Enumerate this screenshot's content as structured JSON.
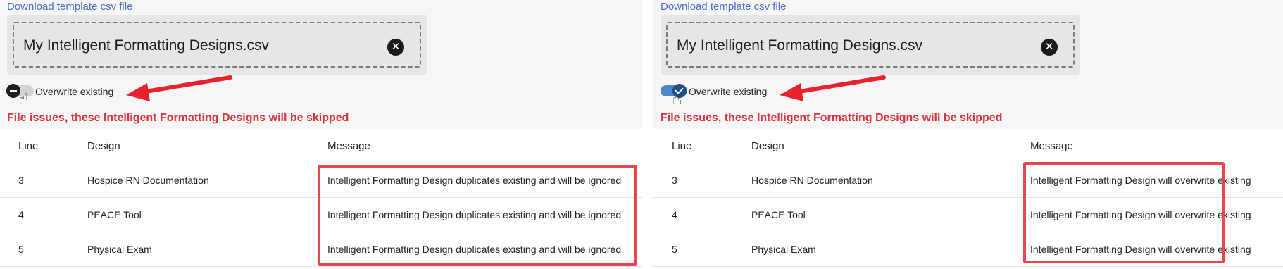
{
  "panels": [
    {
      "download_link": "Download template csv file",
      "file_name": "My Intelligent Formatting Designs.csv",
      "clear_icon": "close-circle-icon",
      "toggle_label": "Overwrite existing",
      "toggle_state": "off",
      "issues_heading": "File issues, these Intelligent Formatting Designs will be skipped",
      "table": {
        "headers": [
          "Line",
          "Design",
          "Message"
        ],
        "rows": [
          {
            "line": "3",
            "design": "Hospice RN Documentation",
            "message": "Intelligent Formatting Design duplicates existing and will be ignored"
          },
          {
            "line": "4",
            "design": "PEACE Tool",
            "message": "Intelligent Formatting Design duplicates existing and will be ignored"
          },
          {
            "line": "5",
            "design": "Physical Exam",
            "message": "Intelligent Formatting Design duplicates existing and will be ignored"
          }
        ]
      }
    },
    {
      "download_link": "Download template csv file",
      "file_name": "My Intelligent Formatting Designs.csv",
      "clear_icon": "close-circle-icon",
      "toggle_label": "Overwrite existing",
      "toggle_state": "on",
      "issues_heading": "File issues, these Intelligent Formatting Designs will be skipped",
      "table": {
        "headers": [
          "Line",
          "Design",
          "Message"
        ],
        "rows": [
          {
            "line": "3",
            "design": "Hospice RN Documentation",
            "message": "Intelligent Formatting Design will overwrite existing"
          },
          {
            "line": "4",
            "design": "PEACE Tool",
            "message": "Intelligent Formatting Design will overwrite existing"
          },
          {
            "line": "5",
            "design": "Physical Exam",
            "message": "Intelligent Formatting Design will overwrite existing"
          }
        ]
      }
    }
  ],
  "colors": {
    "link": "#4a6fc6",
    "error_heading": "#d6333f",
    "annotation_red": "#e8454f",
    "toggle_on": "#4c88c8"
  }
}
